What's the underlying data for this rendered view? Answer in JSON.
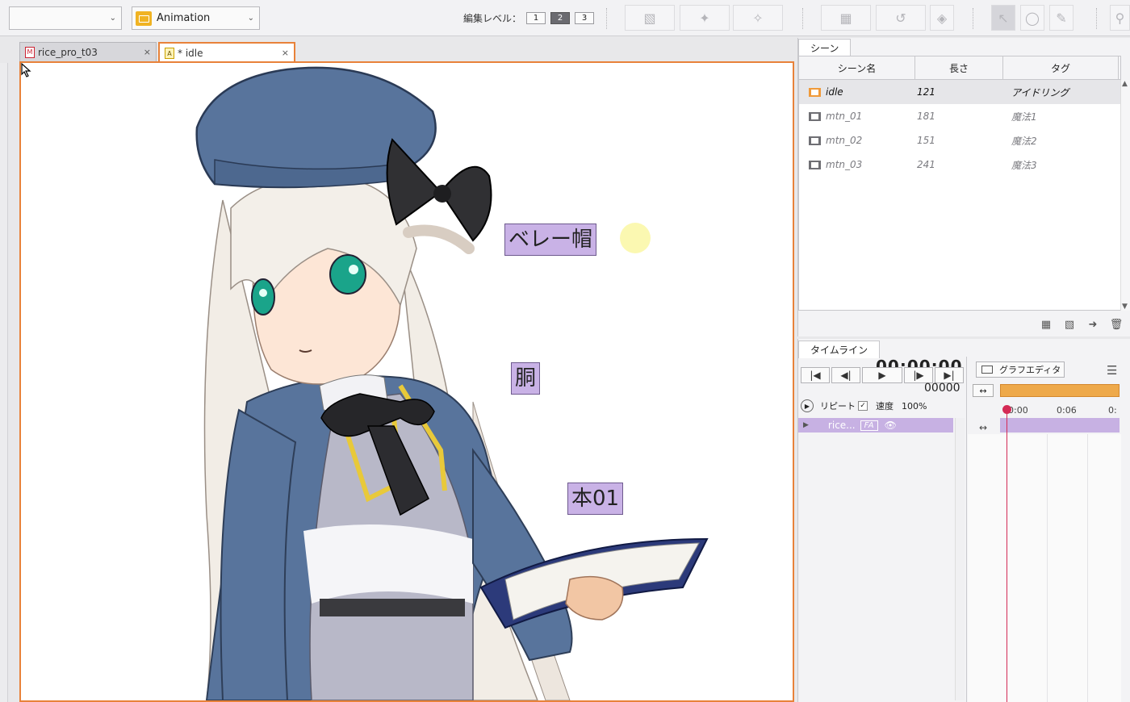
{
  "toolbar": {
    "left_dropdown_value": "",
    "mode_dropdown_value": "Animation",
    "edit_level_label": "編集レベル：",
    "edit_levels": [
      "1",
      "2",
      "3"
    ],
    "edit_level_selected": "2"
  },
  "tabs": [
    {
      "label": "rice_pro_t03",
      "close": "×",
      "active": false
    },
    {
      "label": "* idle",
      "close": "×",
      "active": true
    }
  ],
  "canvas": {
    "labels": {
      "beret": "ベレー帽",
      "body": "胴",
      "book": "本01"
    }
  },
  "scene_panel": {
    "tab": "シーン",
    "columns": [
      "シーン名",
      "長さ",
      "タグ"
    ],
    "rows": [
      {
        "name": "idle",
        "length": "121",
        "tag": "アイドリング",
        "selected": true
      },
      {
        "name": "mtn_01",
        "length": "181",
        "tag": "魔法1",
        "selected": false
      },
      {
        "name": "mtn_02",
        "length": "151",
        "tag": "魔法2",
        "selected": false
      },
      {
        "name": "mtn_03",
        "length": "241",
        "tag": "魔法3",
        "selected": false
      }
    ]
  },
  "timeline": {
    "tab": "タイムライン",
    "time_display": "00:00:00",
    "frame_display": "00000",
    "repeat_label": "リピート",
    "speed_label": "速度",
    "speed_value": "100%",
    "graph_editor_label": "グラフエディタ",
    "ruler_labels": [
      "0:00",
      "0:06",
      "0:"
    ],
    "layer_name": "rice...",
    "layer_badge": "FA"
  }
}
